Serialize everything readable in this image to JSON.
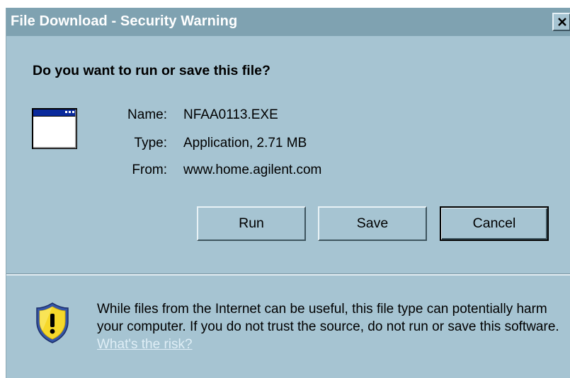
{
  "window": {
    "title": "File Download - Security Warning",
    "close_symbol": "X"
  },
  "dialog": {
    "question": "Do you want to run or save this file?",
    "file_icon": "application-window-icon",
    "info": {
      "name_label": "Name:",
      "name_value": "NFAA0113.EXE",
      "type_label": "Type:",
      "type_value": "Application, 2.71 MB",
      "from_label": "From:",
      "from_value": "www.home.agilent.com"
    },
    "buttons": {
      "run_label": "Run",
      "save_label": "Save",
      "cancel_label": "Cancel"
    },
    "warning": {
      "icon": "shield-warning-icon",
      "text": "While files from the Internet can be useful, this file type can potentially harm your computer. If you do not trust the source, do not run or save this software.",
      "link_text": "What's the risk?"
    }
  },
  "colors": {
    "dialog_background": "#a6c4d2",
    "titlebar_background": "#7fa2b1",
    "link": "#dfeef6"
  }
}
